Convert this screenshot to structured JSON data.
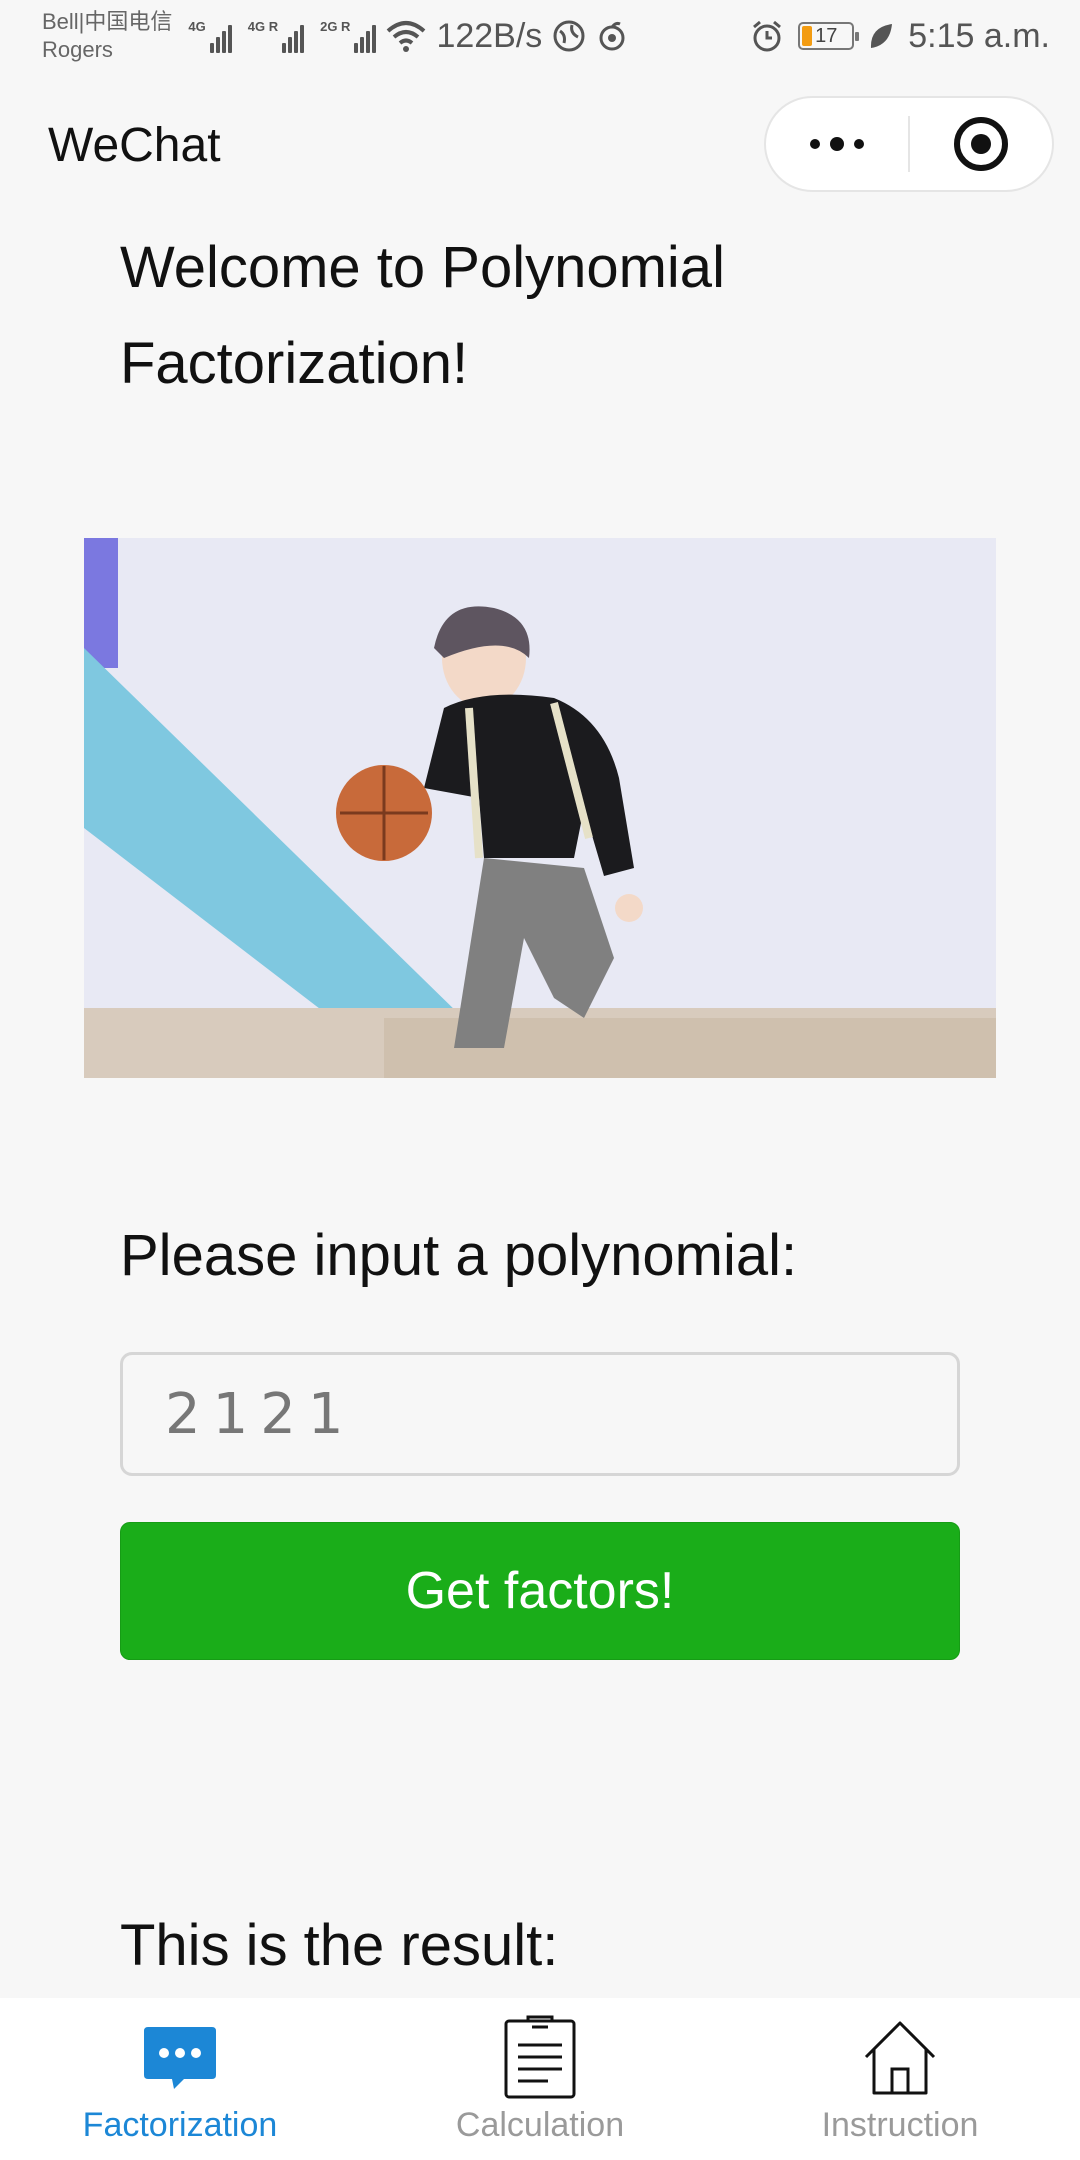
{
  "status_bar": {
    "carrier_line1": "Bell|中国电信",
    "carrier_line2": "Rogers",
    "signals": [
      {
        "tag": "4G",
        "level": 4
      },
      {
        "tag": "4G R",
        "level": 4
      },
      {
        "tag": "2G R",
        "level": 4
      }
    ],
    "net_speed": "122B/s",
    "battery_level": "17",
    "time": "5:15 a.m."
  },
  "navbar": {
    "title": "WeChat"
  },
  "main": {
    "welcome_text": "Welcome to Polynomial Factorization!",
    "image_alt": "person dribbling basketball",
    "prompt_label": "Please input a polynomial:",
    "input_value": "2121",
    "input_placeholder": "",
    "submit_label": "Get factors!",
    "result_label": "This is the result:"
  },
  "tabbar": {
    "tabs": [
      {
        "label": "Factorization",
        "icon": "chat-bubble-icon",
        "active": true
      },
      {
        "label": "Calculation",
        "icon": "clipboard-icon",
        "active": false
      },
      {
        "label": "Instruction",
        "icon": "home-icon",
        "active": false
      }
    ]
  },
  "colors": {
    "accent": "#1c87d6",
    "primary_button": "#1aad19",
    "background": "#f7f7f7"
  }
}
